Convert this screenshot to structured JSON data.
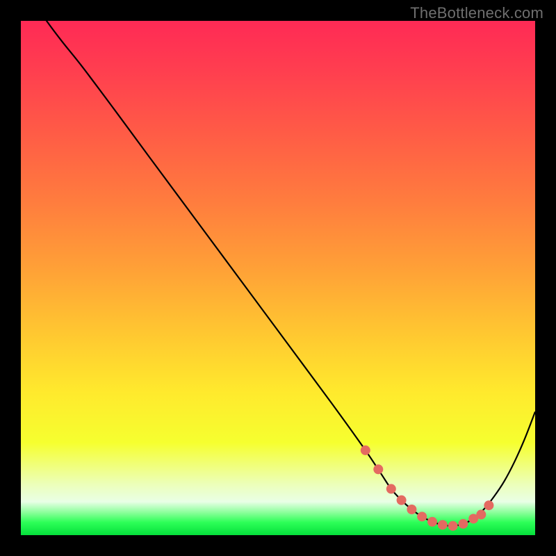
{
  "watermark": "TheBottleneck.com",
  "chart_data": {
    "type": "line",
    "title": "",
    "xlabel": "",
    "ylabel": "",
    "xlim": [
      0,
      100
    ],
    "ylim": [
      0,
      100
    ],
    "series": [
      {
        "name": "curve",
        "x": [
          0,
          3,
          5,
          8,
          12,
          18,
          25,
          35,
          45,
          55,
          62,
          67,
          70,
          72,
          74,
          76,
          78,
          80,
          82,
          84,
          86,
          88,
          90,
          92,
          94,
          96,
          98,
          100
        ],
        "y": [
          108,
          103,
          100,
          96,
          91,
          83,
          73.5,
          60,
          46.5,
          33,
          23.5,
          16.5,
          12,
          9,
          6.8,
          5.0,
          3.6,
          2.6,
          2.0,
          1.8,
          2.2,
          3.2,
          5.0,
          7.5,
          10.5,
          14.3,
          18.8,
          24
        ]
      }
    ],
    "markers": {
      "name": "dots",
      "color": "#e46a61",
      "x": [
        67,
        69.5,
        72,
        74,
        76,
        78,
        80,
        82,
        84,
        86,
        88,
        89.5,
        91
      ],
      "y": [
        16.5,
        12.8,
        9.0,
        6.8,
        5.0,
        3.6,
        2.6,
        2.0,
        1.8,
        2.2,
        3.2,
        4.0,
        5.8
      ]
    },
    "gradient_stops": [
      {
        "offset": 0.0,
        "color": "#ff2a55"
      },
      {
        "offset": 0.1,
        "color": "#ff3f4f"
      },
      {
        "offset": 0.22,
        "color": "#ff5c46"
      },
      {
        "offset": 0.35,
        "color": "#ff7c3e"
      },
      {
        "offset": 0.48,
        "color": "#ffa037"
      },
      {
        "offset": 0.6,
        "color": "#ffc531"
      },
      {
        "offset": 0.72,
        "color": "#ffe92d"
      },
      {
        "offset": 0.82,
        "color": "#f6ff2f"
      },
      {
        "offset": 0.9,
        "color": "#ecffb8"
      },
      {
        "offset": 0.935,
        "color": "#e9ffe6"
      },
      {
        "offset": 0.955,
        "color": "#8fff9e"
      },
      {
        "offset": 0.975,
        "color": "#2dff58"
      },
      {
        "offset": 1.0,
        "color": "#05e03b"
      }
    ]
  }
}
